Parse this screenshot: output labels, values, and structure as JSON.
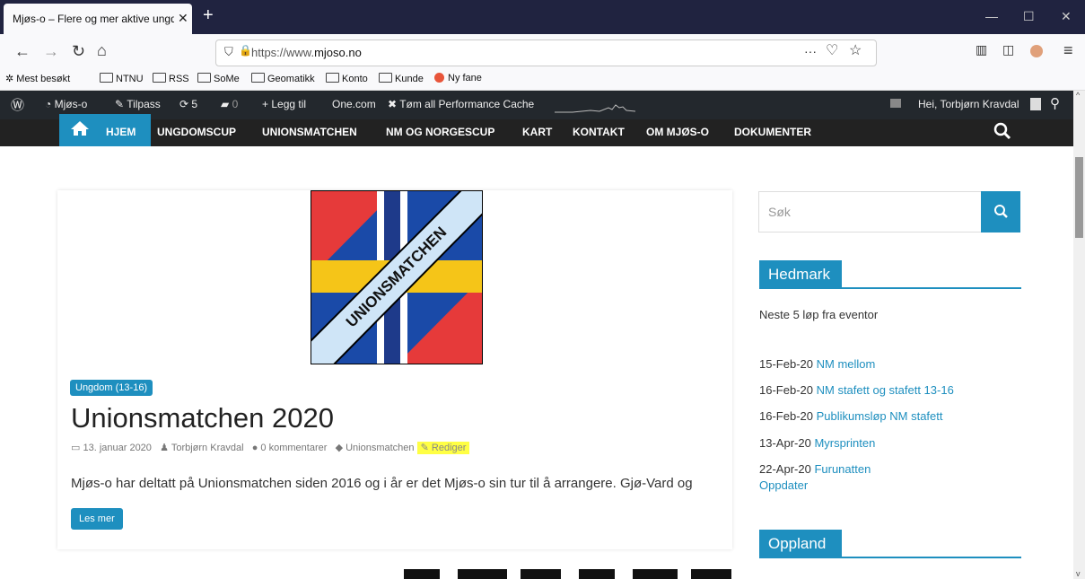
{
  "browser": {
    "tab_title": "Mjøs-o – Flere og mer aktive ungdom",
    "tab_close": "✕",
    "new_tab": "+",
    "url_prefix": "https://www.",
    "url_domain": "mjoso.no",
    "url_dots": "···",
    "window_controls": [
      "—",
      "☐",
      "✕"
    ]
  },
  "bookmarks": [
    "Mest besøkt",
    "NTNU",
    "RSS",
    "SoMe",
    "Geomatikk",
    "Konto",
    "Kunde",
    "Ny fane"
  ],
  "adminbar": {
    "site": "Mjøs-o",
    "customize": "Tilpass",
    "updates": "5",
    "comments": "0",
    "new": "Legg til",
    "onecom": "One.com",
    "cache": "Tøm all Performance Cache",
    "greeting": "Hei, Torbjørn Kravdal"
  },
  "menu": [
    "HJEM",
    "UNGDOMSCUP",
    "UNIONSMATCHEN",
    "NM OG NORGESCUP",
    "KART",
    "KONTAKT",
    "OM MJØS-O",
    "DOKUMENTER"
  ],
  "post": {
    "logo_text": "UNIONSMATCHEN",
    "category": "Ungdom (13-16)",
    "title": "Unionsmatchen 2020",
    "date": "13. januar 2020",
    "author": "Torbjørn Kravdal",
    "comments": "0 kommentarer",
    "tag": "Unionsmatchen",
    "edit": "Rediger",
    "excerpt": "Mjøs-o har deltatt på Unionsmatchen siden 2016 og i år er det Mjøs-o sin tur til å arrangere. Gjø-Vard og",
    "read_more": "Les mer"
  },
  "sidebar": {
    "search_placeholder": "Søk",
    "hedmark_title": "Hedmark",
    "hedmark_intro": "Neste 5 løp fra eventor",
    "events": [
      {
        "date": "15-Feb-20",
        "name": "NM mellom"
      },
      {
        "date": "16-Feb-20",
        "name": "NM stafett og stafett 13-16"
      },
      {
        "date": "16-Feb-20",
        "name": "Publikumsløp NM stafett"
      },
      {
        "date": "13-Apr-20",
        "name": "Myrsprinten"
      },
      {
        "date": "22-Apr-20",
        "name": "Furunatten"
      }
    ],
    "update_link": "Oppdater",
    "oppland_title": "Oppland"
  },
  "colors": {
    "accent": "#1e8fbf",
    "admin_bar": "#23282d",
    "nav_bar": "#222222",
    "titlebar": "#202340",
    "highlight": "#ffff44"
  }
}
